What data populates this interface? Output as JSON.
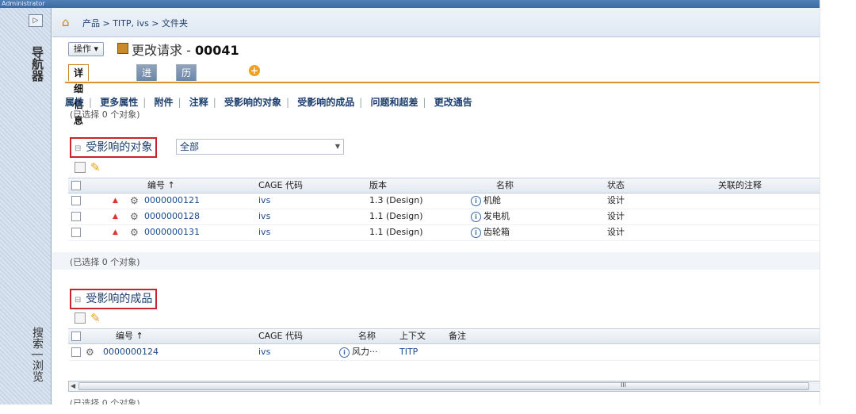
{
  "window": {
    "user": "Administrator"
  },
  "sidebar": {
    "nav_label": "导航器",
    "bottom_label": "搜索 | 浏览"
  },
  "breadcrumb": {
    "text": "产品 > TITP, ivs > 文件夹"
  },
  "header": {
    "action_label": "操作 ▾",
    "title_prefix": "更改请求 - ",
    "title_number": "00041",
    "tabs": [
      "详细信息",
      "进程",
      "历史记录"
    ]
  },
  "subnav": [
    "属性",
    "更多属性",
    "附件",
    "注释",
    "受影响的对象",
    "受影响的成品",
    "问题和超差",
    "更改通告"
  ],
  "selected_top": "(已选择 0 个对象)",
  "affected_objects": {
    "title": "受影响的对象",
    "filter_value": "全部",
    "columns": [
      "编号 ↑",
      "CAGE 代码",
      "版本",
      "名称",
      "状态",
      "关联的注释"
    ],
    "rows": [
      {
        "number": "0000000121",
        "cage": "ivs",
        "version": "1.3 (Design)",
        "name": "机舱",
        "status": "设计"
      },
      {
        "number": "0000000128",
        "cage": "ivs",
        "version": "1.1 (Design)",
        "name": "发电机",
        "status": "设计"
      },
      {
        "number": "0000000131",
        "cage": "ivs",
        "version": "1.1 (Design)",
        "name": "齿轮箱",
        "status": "设计"
      }
    ],
    "selected": "(已选择 0 个对象)"
  },
  "affected_products": {
    "title": "受影响的成品",
    "columns": [
      "编号 ↑",
      "CAGE 代码",
      "名称",
      "上下文",
      "备注"
    ],
    "rows": [
      {
        "number": "0000000124",
        "cage": "ivs",
        "name": "风力···",
        "context": "TITP"
      }
    ],
    "selected": "(已选择 0 个对象)"
  },
  "scrollbar": {
    "grip": "III"
  }
}
